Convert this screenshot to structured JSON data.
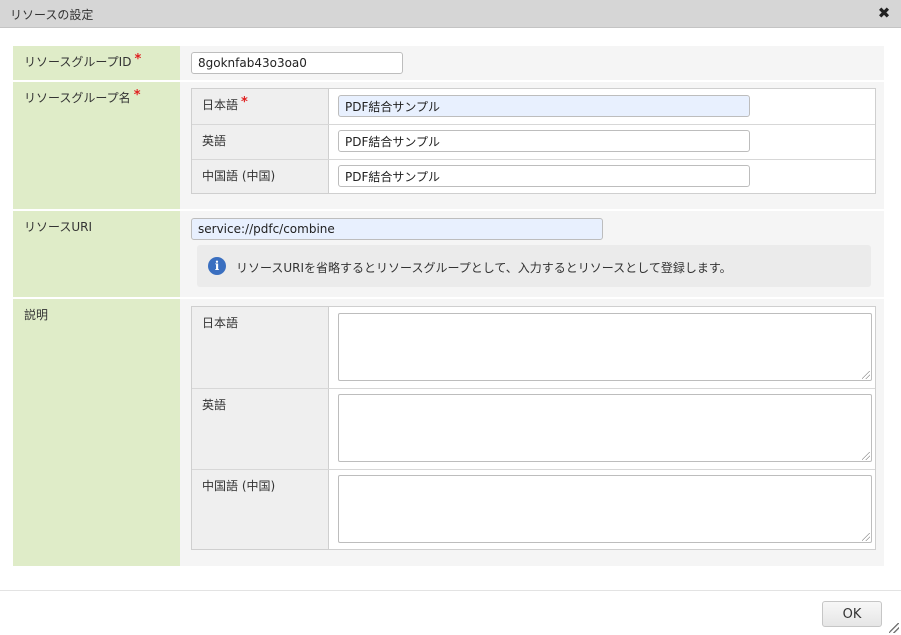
{
  "dialog": {
    "title": "リソースの設定",
    "close_glyph": "✖"
  },
  "fields": {
    "group_id": {
      "label": "リソースグループID",
      "required_mark": "*",
      "value": "8goknfab43o3oa0"
    },
    "group_name": {
      "label": "リソースグループ名",
      "required_mark": "*",
      "rows": [
        {
          "lang": "日本語",
          "required_mark": "*",
          "value": "PDF結合サンプル"
        },
        {
          "lang": "英語",
          "value": "PDF結合サンプル"
        },
        {
          "lang": "中国語 (中国)",
          "value": "PDF結合サンプル"
        }
      ]
    },
    "resource_uri": {
      "label": "リソースURI",
      "value": "service://pdfc/combine",
      "info_icon_glyph": "i",
      "info_text": "リソースURIを省略するとリソースグループとして、入力するとリソースとして登録します。"
    },
    "description": {
      "label": "説明",
      "rows": [
        {
          "lang": "日本語",
          "value": ""
        },
        {
          "lang": "英語",
          "value": ""
        },
        {
          "lang": "中国語 (中国)",
          "value": ""
        }
      ]
    }
  },
  "footer": {
    "ok_label": "OK"
  },
  "icons": {
    "close": "close-icon",
    "info": "info-icon",
    "resize": "resize-grip-icon"
  },
  "colors": {
    "label_bg": "#dfecc8",
    "required": "#e02020",
    "info_icon": "#3a6fc0",
    "highlight_input": "#e8f0fe"
  }
}
